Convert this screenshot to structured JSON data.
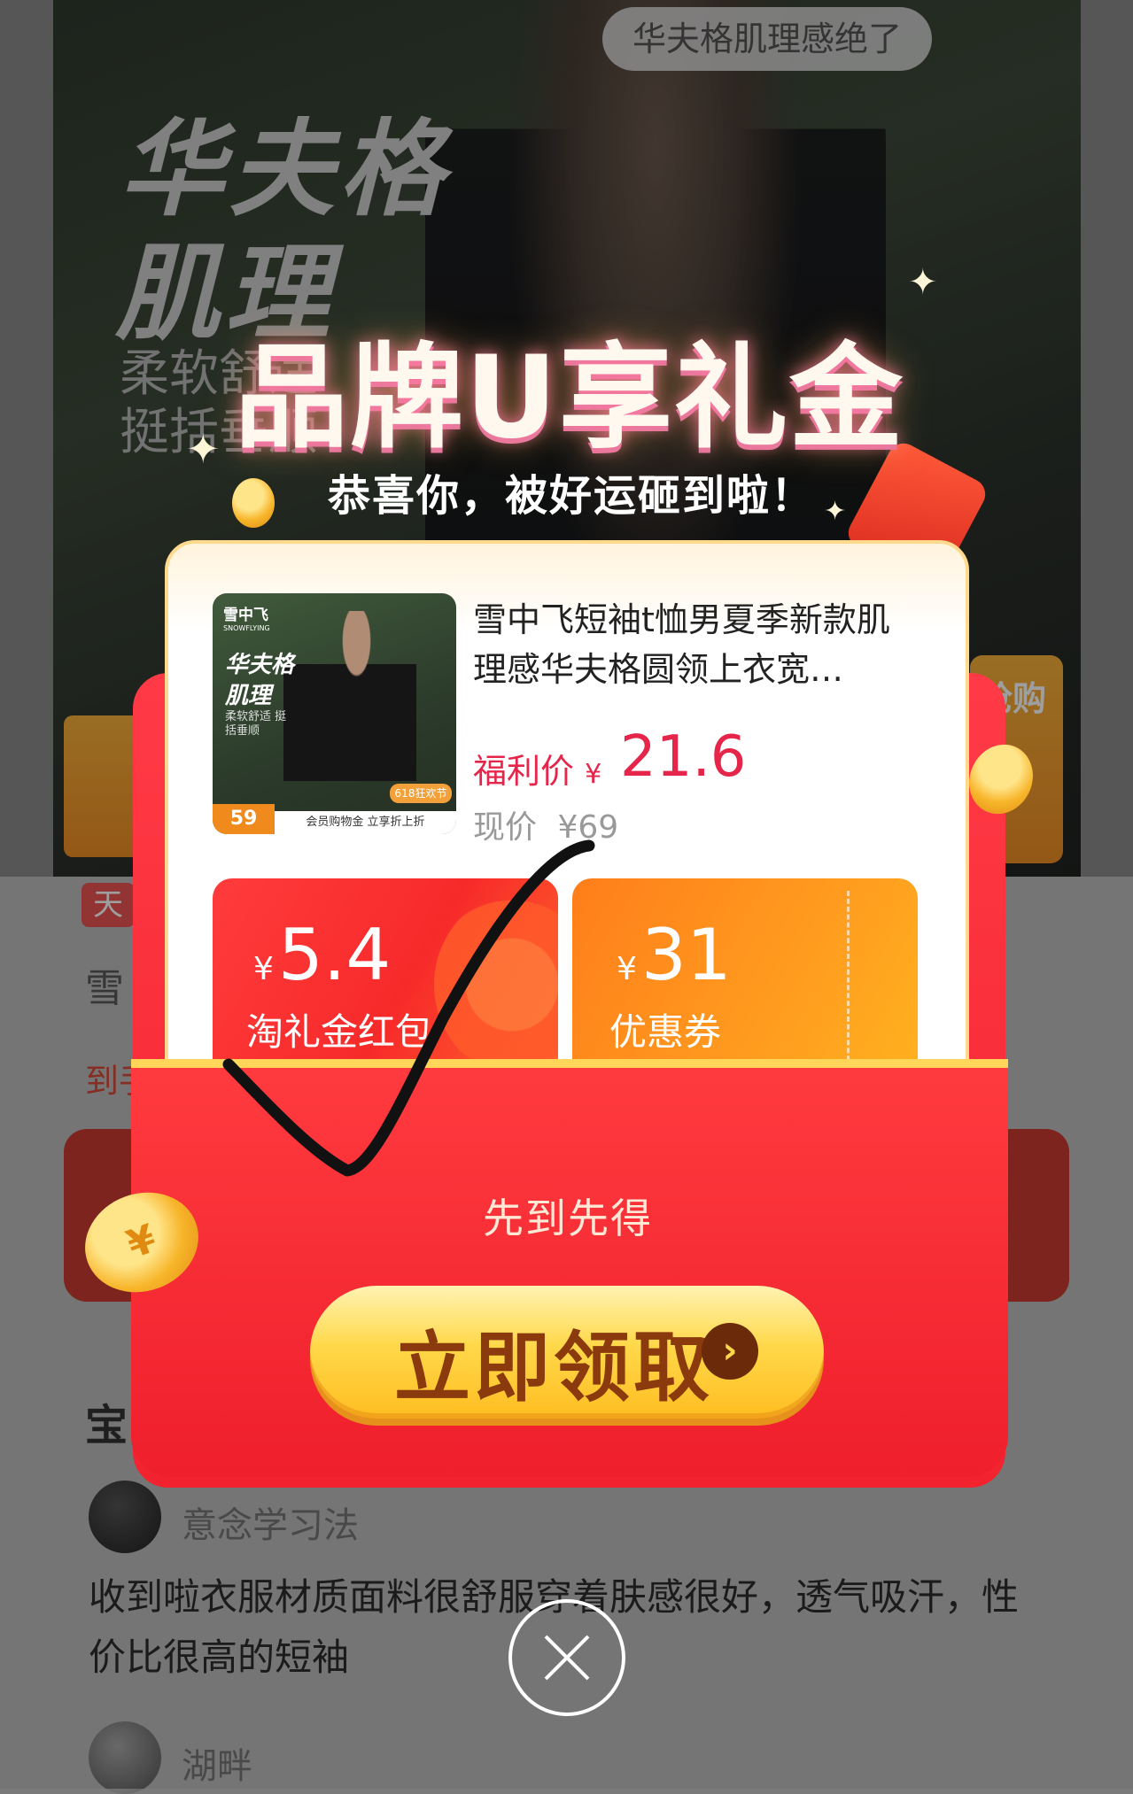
{
  "background_page": {
    "hero_chip": "华夫格肌理感绝了",
    "hero_title_line1": "华夫格",
    "hero_title_line2": "肌理",
    "hero_sub_line1": "柔软舒适",
    "hero_sub_line2": "挺括垂顺",
    "tmall_tag": "天",
    "partial_title": "雪",
    "partial_link": "到手",
    "review_section_title": "宝",
    "review1_user": "意念学习法",
    "review1_text": "收到啦衣服材质面料很舒服穿着肤感很好，透气吸汗，性价比很高的短袖",
    "review2_user": "湖畔",
    "side_button_text": "抢购"
  },
  "popup": {
    "title": "品牌U享礼金",
    "subtitle": "恭喜你，被好运砸到啦！",
    "product": {
      "name": "雪中飞短袖t恤男夏季新款肌理感华夫格圆领上衣宽…",
      "image_logo": "雪中飞",
      "image_logo_en": "SNOWFLYING",
      "image_title1": "华夫格",
      "image_title2": "肌理",
      "image_sub": "柔软舒适 挺括垂顺",
      "image_badge": "59",
      "image_strip": "会员购物金 立享折上折",
      "image_618": "618狂欢节",
      "welfare_label": "福利价",
      "currency": "¥",
      "welfare_price": "21.6",
      "current_label": "现价",
      "current_price": "¥69"
    },
    "coupons": [
      {
        "currency": "¥",
        "amount": "5.4",
        "label": "淘礼金红包"
      },
      {
        "currency": "¥",
        "amount": "31",
        "label": "优惠券"
      }
    ],
    "notice": "先到先得",
    "claim_button": "立即领取",
    "claim_arrow": "›",
    "close_icon": "×"
  },
  "colors": {
    "price_red": "#e5264a",
    "envelope_red": "#f2232f",
    "button_gold": "#ffd84a",
    "coupon_orange": "#ff9c1f"
  }
}
